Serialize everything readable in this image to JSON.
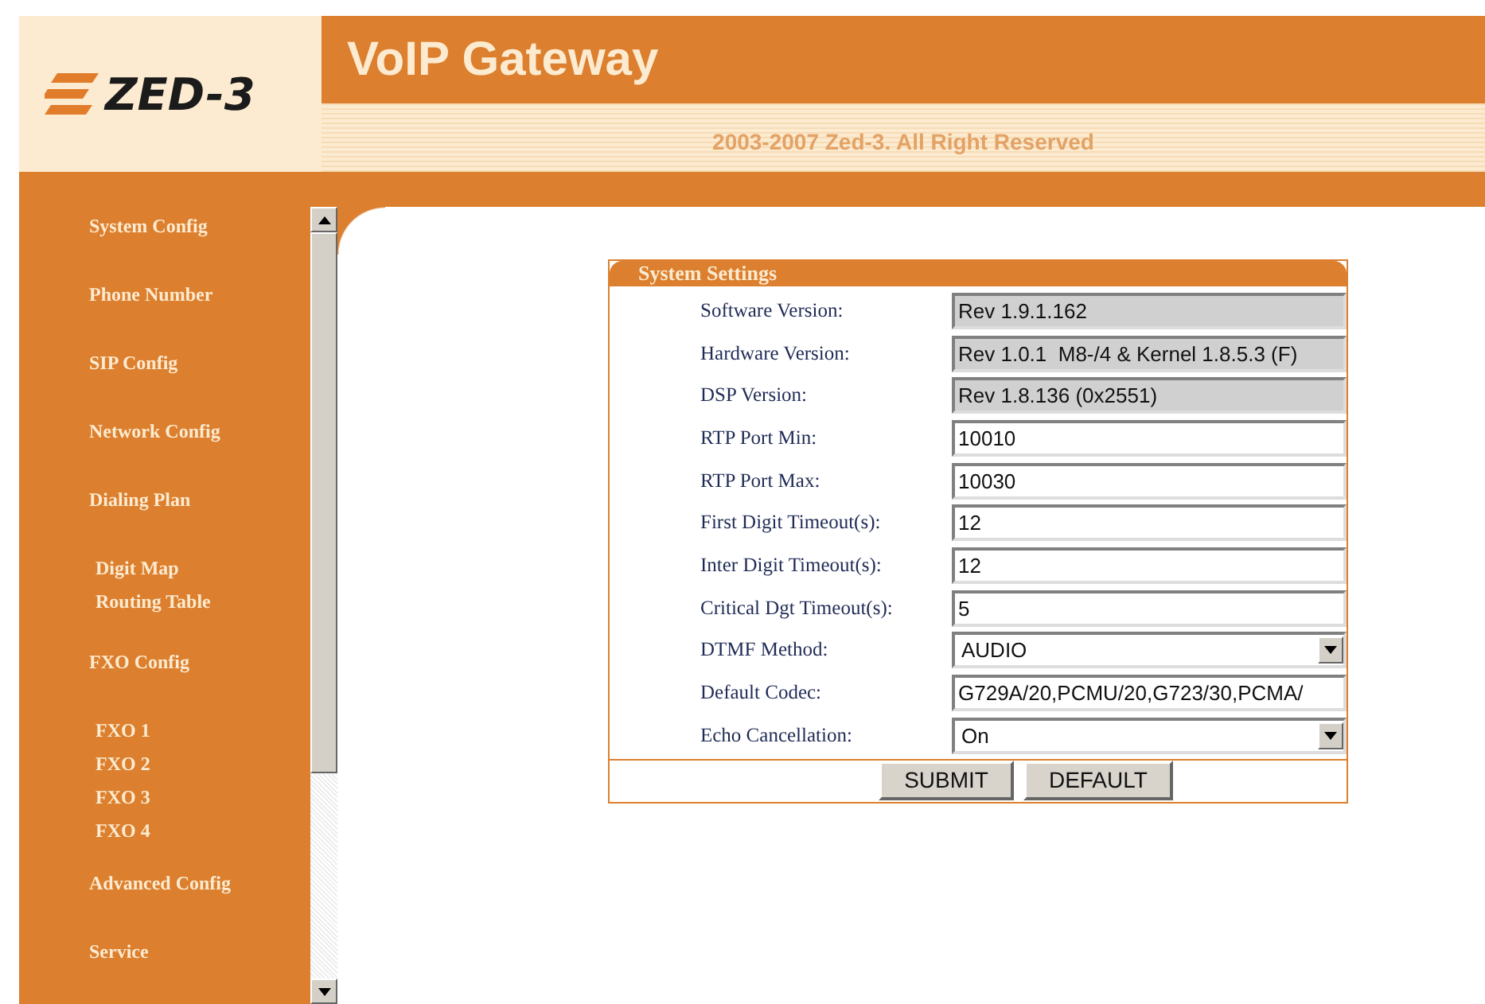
{
  "header": {
    "logo": "ZED-3",
    "title": "VoIP Gateway",
    "copyright": "2003-2007 Zed-3. All Right Reserved"
  },
  "sidebar": {
    "items": [
      {
        "label": "System Config"
      },
      {
        "label": "Phone Number"
      },
      {
        "label": "SIP Config"
      },
      {
        "label": "Network Config"
      },
      {
        "label": "Dialing Plan",
        "children": [
          {
            "label": "Digit Map"
          },
          {
            "label": "Routing Table"
          }
        ]
      },
      {
        "label": "FXO Config",
        "children": [
          {
            "label": "FXO 1"
          },
          {
            "label": "FXO 2"
          },
          {
            "label": "FXO 3"
          },
          {
            "label": "FXO 4"
          }
        ]
      },
      {
        "label": "Advanced Config"
      },
      {
        "label": "Service"
      }
    ]
  },
  "panel": {
    "title": "System Settings",
    "fields": [
      {
        "label": "Software Version:",
        "kind": "readonly",
        "value": "Rev 1.9.1.162"
      },
      {
        "label": "Hardware Version:",
        "kind": "readonly",
        "value": "Rev 1.0.1  M8-/4 & Kernel 1.8.5.3 (F)"
      },
      {
        "label": "DSP Version:",
        "kind": "readonly",
        "value": "Rev 1.8.136 (0x2551)"
      },
      {
        "label": "RTP Port Min:",
        "kind": "text",
        "value": "10010"
      },
      {
        "label": "RTP Port Max:",
        "kind": "text",
        "value": "10030"
      },
      {
        "label": "First Digit Timeout(s):",
        "kind": "text",
        "value": "12"
      },
      {
        "label": "Inter Digit Timeout(s):",
        "kind": "text",
        "value": "12"
      },
      {
        "label": "Critical Dgt Timeout(s):",
        "kind": "text",
        "value": "5"
      },
      {
        "label": "DTMF Method:",
        "kind": "select",
        "value": "AUDIO"
      },
      {
        "label": "Default Codec:",
        "kind": "text",
        "value": "G729A/20,PCMU/20,G723/30,PCMA/"
      },
      {
        "label": "Echo Cancellation:",
        "kind": "select",
        "value": "On"
      }
    ],
    "buttons": [
      "SUBMIT",
      "DEFAULT"
    ]
  }
}
